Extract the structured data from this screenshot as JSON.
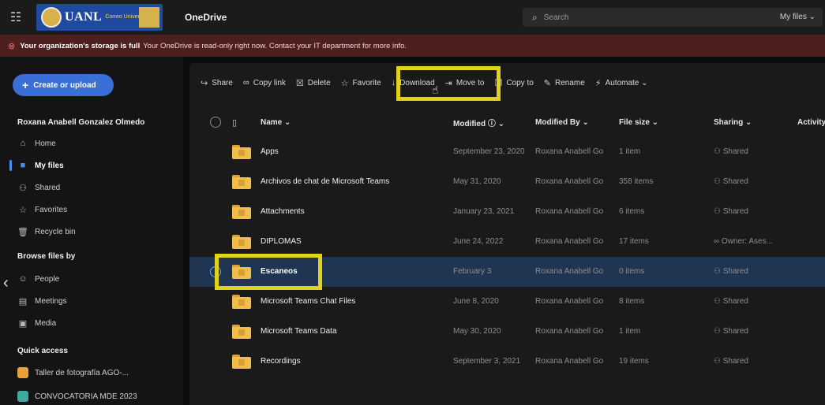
{
  "topbar": {
    "logo_text": "UANL",
    "logo_sub": "Correo Universitario",
    "app_name": "OneDrive",
    "search_placeholder": "Search",
    "scope": "My files"
  },
  "banner": {
    "bold": "Your organization's storage is full",
    "message": "Your OneDrive is read-only right now. Contact your IT department for more info."
  },
  "sidebar": {
    "create_label": "Create or upload",
    "user_name": "Roxana Anabell Gonzalez Olmedo",
    "nav": [
      {
        "label": "Home",
        "icon": "home-icon"
      },
      {
        "label": "My files",
        "icon": "folder-icon"
      },
      {
        "label": "Shared",
        "icon": "shared-icon"
      },
      {
        "label": "Favorites",
        "icon": "star-icon"
      },
      {
        "label": "Recycle bin",
        "icon": "trash-icon"
      }
    ],
    "browse_header": "Browse files by",
    "browse": [
      {
        "label": "People",
        "icon": "person-icon"
      },
      {
        "label": "Meetings",
        "icon": "calendar-icon"
      },
      {
        "label": "Media",
        "icon": "media-icon"
      }
    ],
    "quick_header": "Quick access",
    "quick": [
      {
        "label": "Taller de fotografía AGO-...",
        "color": "#e8a23c"
      },
      {
        "label": "CONVOCATORIA MDE 2023",
        "color": "#3fa9a0"
      }
    ]
  },
  "toolbar": {
    "share": "Share",
    "copy_link": "Copy link",
    "delete": "Delete",
    "favorite": "Favorite",
    "download": "Download",
    "move_to": "Move to",
    "copy_to": "Copy to",
    "rename": "Rename",
    "automate": "Automate"
  },
  "columns": {
    "name": "Name",
    "modified": "Modified",
    "modified_by": "Modified By",
    "file_size": "File size",
    "sharing": "Sharing",
    "activity": "Activity"
  },
  "files": [
    {
      "name": "Apps",
      "modified": "September 23, 2020",
      "by": "Roxana Anabell Go",
      "size": "1 item",
      "sharing": "Shared"
    },
    {
      "name": "Archivos de chat de Microsoft Teams",
      "modified": "May 31, 2020",
      "by": "Roxana Anabell Go",
      "size": "358 items",
      "sharing": "Shared"
    },
    {
      "name": "Attachments",
      "modified": "January 23, 2021",
      "by": "Roxana Anabell Go",
      "size": "6 items",
      "sharing": "Shared"
    },
    {
      "name": "DIPLOMAS",
      "modified": "June 24, 2022",
      "by": "Roxana Anabell Go",
      "size": "17 items",
      "sharing": "Owner: Ases..."
    },
    {
      "name": "Escaneos",
      "modified": "February 3",
      "by": "Roxana Anabell Go",
      "size": "0 items",
      "sharing": "Shared"
    },
    {
      "name": "Microsoft Teams Chat Files",
      "modified": "June 8, 2020",
      "by": "Roxana Anabell Go",
      "size": "8 items",
      "sharing": "Shared"
    },
    {
      "name": "Microsoft Teams Data",
      "modified": "May 30, 2020",
      "by": "Roxana Anabell Go",
      "size": "1 item",
      "sharing": "Shared"
    },
    {
      "name": "Recordings",
      "modified": "September 3, 2021",
      "by": "Roxana Anabell Go",
      "size": "19 items",
      "sharing": "Shared"
    }
  ],
  "colors": {
    "accent": "#3a6fd8",
    "highlight": "#e3d21a",
    "banner": "#4e1f1f",
    "selected_row": "#203552"
  }
}
